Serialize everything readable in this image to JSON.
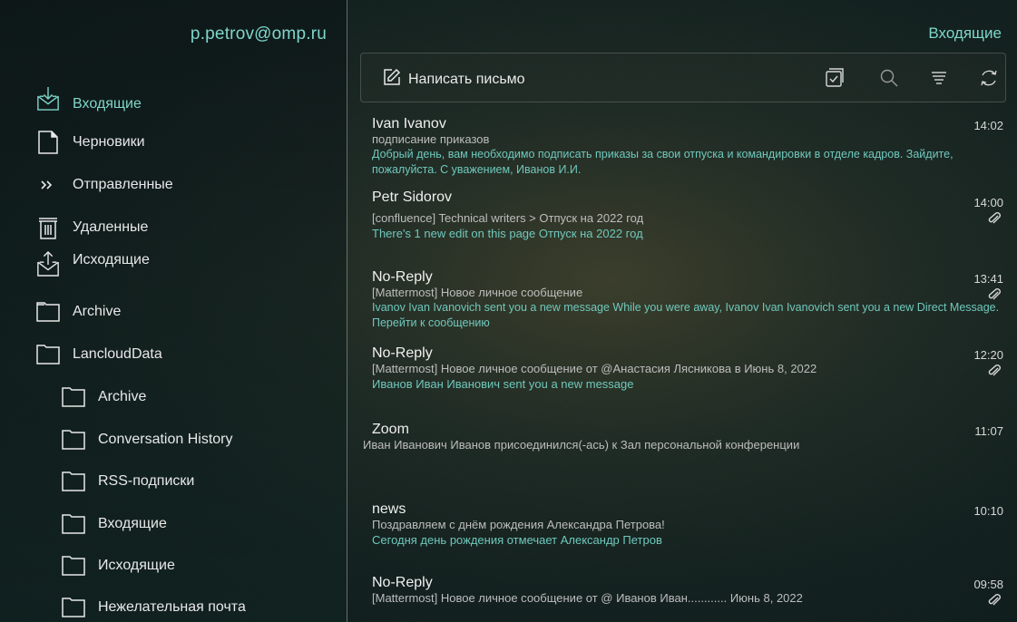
{
  "account": "p.petrov@omp.ru",
  "header": {
    "title": "Входящие"
  },
  "toolbar": {
    "compose_label": "Написать письмо",
    "icons": [
      "select-icon",
      "search-icon",
      "filter-icon",
      "refresh-icon"
    ]
  },
  "folders": [
    {
      "label": "Входящие",
      "icon": "inbox-icon",
      "active": true
    },
    {
      "label": "Черновики",
      "icon": "draft-icon"
    },
    {
      "label": "Отправленные",
      "icon": "sent-icon"
    },
    {
      "label": "Удаленные",
      "icon": "trash-icon"
    },
    {
      "label": "Исходящие",
      "icon": "outbox-icon"
    },
    {
      "label": "Archive",
      "icon": "folder-icon"
    },
    {
      "label": "LancloudData",
      "icon": "folder-icon"
    },
    {
      "label": "Archive",
      "icon": "folder-icon"
    },
    {
      "label": "Conversation History",
      "icon": "folder-icon"
    },
    {
      "label": "RSS-подписки",
      "icon": "folder-icon"
    },
    {
      "label": "Входящие",
      "icon": "folder-icon"
    },
    {
      "label": "Исходящие",
      "icon": "folder-icon"
    },
    {
      "label": "Нежелательная почта",
      "icon": "folder-icon"
    }
  ],
  "messages": [
    {
      "sender": "Ivan Ivanov",
      "subject": "подписание приказов",
      "preview": "Добрый день, вам необходимо подписать приказы за свои отпуска и командировки в отделе кадров. Зайдите, пожалуйста. С уважением,  Иванов И.И.",
      "time": "14:02",
      "attachment": false
    },
    {
      "sender": "Petr Sidorov",
      "subject": "[confluence] Technical writers > Отпуск на 2022 год",
      "preview": "There's 1 new edit on this page  Отпуск на 2022 год",
      "time": "14:00",
      "attachment": true
    },
    {
      "sender": "No-Reply",
      "subject": "[Mattermost] Новое личное сообщение",
      "preview": "Ivanov Ivan  Ivanovich sent you a new message While you were away, Ivanov Ivan Ivanovich sent you a new Direct Message. Перейти к сообщению",
      "time": "13:41",
      "attachment": true
    },
    {
      "sender": "No-Reply",
      "subject": "[Mattermost] Новое личное сообщение от @Анастасия Лясникова в Июнь 8, 2022",
      "preview": "Иванов Иван Иванович sent you a new message",
      "time": "12:20",
      "attachment": true
    },
    {
      "sender": "Zoom",
      "subject": "Иван Иванович Иванов  присоединился(-ась) к Зал персональной конференции",
      "preview": "",
      "time": "11:07",
      "attachment": false
    },
    {
      "sender": "news",
      "subject": "Поздравляем с днём рождения Александра Петрова!",
      "preview": "Сегодня день рождения отмечает  Александр Петров",
      "time": "10:10",
      "attachment": false
    },
    {
      "sender": "No-Reply",
      "subject": "[Mattermost] Новое личное сообщение от @ Иванов Иван............ Июнь 8, 2022",
      "preview": "",
      "time": "09:58",
      "attachment": true
    }
  ],
  "colors": {
    "accent": "#7fd6cb",
    "preview": "#6fc8bd",
    "text": "#e8e8e8"
  }
}
